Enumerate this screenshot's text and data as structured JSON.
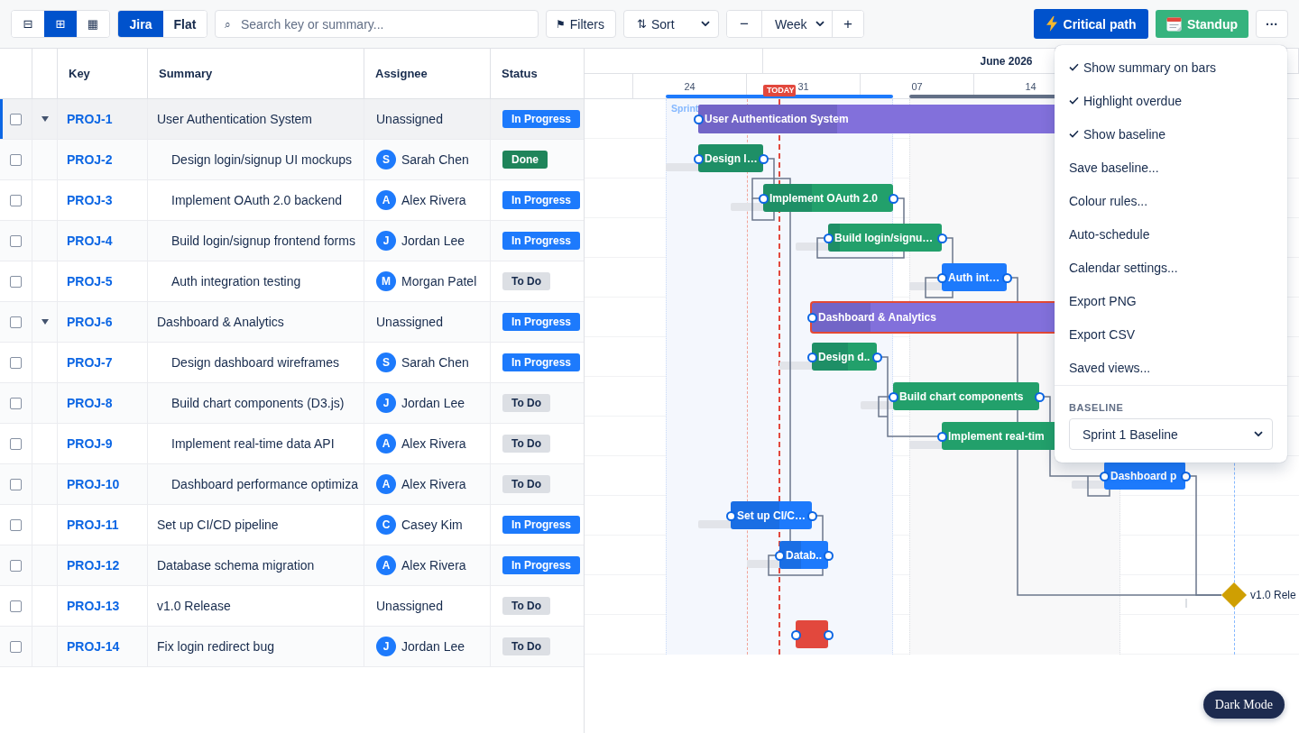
{
  "toolbar": {
    "view_modes": [
      {
        "icon": "⊟",
        "selected": false
      },
      {
        "icon": "⊞",
        "selected": true
      },
      {
        "icon": "▦",
        "selected": false
      }
    ],
    "hierarchy_modes": [
      {
        "label": "Jira",
        "selected": true
      },
      {
        "label": "Flat",
        "selected": false
      }
    ],
    "search": {
      "icon": "⌕",
      "placeholder": "Search key or summary..."
    },
    "filters": {
      "icon": "⚑",
      "label": "Filters"
    },
    "sort": {
      "icon": "⇅",
      "label": "Sort"
    },
    "zoom": {
      "decrease": "−",
      "scale": "Week",
      "increase": "+"
    },
    "critical_path": {
      "label": "Critical path"
    },
    "standup": {
      "label": "Standup"
    },
    "more": {
      "label": "···"
    }
  },
  "table": {
    "columns": [
      "Key",
      "Summary",
      "Assignee",
      "Status"
    ],
    "rows": [
      {
        "key": "PROJ-1",
        "summary": "User Authentication System",
        "assignee": {
          "name": "Unassigned"
        },
        "status": {
          "label": "In Progress",
          "kind": "in_progress"
        },
        "checked": false,
        "selected": true,
        "expanded": true,
        "bar": {
          "kind": "summary",
          "label": "User Authentication System",
          "color": "#8270db",
          "level": 0.39,
          "overdue": false
        },
        "children": [
          {
            "key": "PROJ-2",
            "summary": "Design login/signup UI mockups",
            "assignee": {
              "name": "Sarah Chen",
              "initial": "S"
            },
            "status": {
              "label": "Done",
              "kind": "done"
            },
            "checked": false,
            "selected": false,
            "bar": {
              "kind": "task",
              "label": "Design l…",
              "color": "#22a06b",
              "level": 1,
              "overdue": false
            }
          },
          {
            "key": "PROJ-3",
            "summary": "Implement OAuth 2.0 backend",
            "assignee": {
              "name": "Alex Rivera",
              "initial": "A"
            },
            "status": {
              "label": "In Progress",
              "kind": "in_progress"
            },
            "checked": false,
            "selected": false,
            "bar": {
              "kind": "task",
              "label": "Implement OAuth 2.0",
              "color": "#22a06b",
              "level": 0.375,
              "overdue": false
            }
          },
          {
            "key": "PROJ-4",
            "summary": "Build login/signup frontend forms",
            "assignee": {
              "name": "Jordan Lee",
              "initial": "J"
            },
            "status": {
              "label": "In Progress",
              "kind": "in_progress"
            },
            "checked": false,
            "selected": false,
            "bar": {
              "kind": "task",
              "label": "Build login/signu…",
              "color": "#22a06b",
              "level": 0.1,
              "overdue": false
            }
          },
          {
            "key": "PROJ-5",
            "summary": "Auth integration testing",
            "assignee": {
              "name": "Morgan Patel",
              "initial": "M"
            },
            "status": {
              "label": "To Do",
              "kind": "todo"
            },
            "checked": false,
            "selected": false,
            "bar": {
              "kind": "task",
              "label": "Auth int…",
              "color": "#1d7afc",
              "overdue": false
            }
          }
        ]
      },
      {
        "key": "PROJ-6",
        "summary": "Dashboard & Analytics",
        "assignee": {
          "name": "Unassigned"
        },
        "status": {
          "label": "In Progress",
          "kind": "in_progress"
        },
        "checked": false,
        "selected": false,
        "expanded": true,
        "bar": {
          "kind": "summary",
          "label": "Dashboard & Analytics",
          "color": "#8270db",
          "level": 0.24,
          "overdue": true
        },
        "children": [
          {
            "key": "PROJ-7",
            "summary": "Design dashboard wireframes",
            "assignee": {
              "name": "Sarah Chen",
              "initial": "S"
            },
            "status": {
              "label": "In Progress",
              "kind": "in_progress"
            },
            "checked": false,
            "selected": false,
            "bar": {
              "kind": "task",
              "label": "Design d..",
              "color": "#22a06b",
              "level": 0.55,
              "overdue": false
            }
          },
          {
            "key": "PROJ-8",
            "summary": "Build chart components (D3.js)",
            "assignee": {
              "name": "Jordan Lee",
              "initial": "J"
            },
            "status": {
              "label": "To Do",
              "kind": "todo"
            },
            "checked": false,
            "selected": false,
            "bar": {
              "kind": "task",
              "label": "Build chart components",
              "color": "#22a06b",
              "overdue": false
            }
          },
          {
            "key": "PROJ-9",
            "summary": "Implement real-time data API",
            "assignee": {
              "name": "Alex Rivera",
              "initial": "A"
            },
            "status": {
              "label": "To Do",
              "kind": "todo"
            },
            "checked": false,
            "selected": false,
            "bar": {
              "kind": "task",
              "label": "Implement real-tim",
              "color": "#22a06b",
              "overdue": false
            }
          },
          {
            "key": "PROJ-10",
            "summary": "Dashboard performance optimiza",
            "assignee": {
              "name": "Alex Rivera",
              "initial": "A"
            },
            "status": {
              "label": "To Do",
              "kind": "todo"
            },
            "checked": false,
            "selected": false,
            "bar": {
              "kind": "task",
              "label": "Dashboard p",
              "color": "#1d7afc",
              "overdue": false
            }
          }
        ]
      },
      {
        "key": "PROJ-11",
        "summary": "Set up CI/CD pipeline",
        "assignee": {
          "name": "Casey Kim",
          "initial": "C"
        },
        "status": {
          "label": "In Progress",
          "kind": "in_progress"
        },
        "checked": false,
        "selected": false,
        "bar": {
          "kind": "task",
          "label": "Set up CI/C…",
          "color": "#1d7afc",
          "level": 0.6,
          "overdue": false
        }
      },
      {
        "key": "PROJ-12",
        "summary": "Database schema migration",
        "assignee": {
          "name": "Alex Rivera",
          "initial": "A"
        },
        "status": {
          "label": "In Progress",
          "kind": "in_progress"
        },
        "checked": false,
        "selected": false,
        "bar": {
          "kind": "task",
          "label": "Datab..",
          "color": "#1d7afc",
          "level": 0.45,
          "overdue": false
        }
      },
      {
        "key": "PROJ-13",
        "summary": "v1.0 Release",
        "assignee": {
          "name": "Unassigned"
        },
        "status": {
          "label": "To Do",
          "kind": "todo"
        },
        "checked": false,
        "selected": false,
        "bar": {
          "kind": "milestone",
          "label": "v1.0 Rele",
          "color": "#cf9f02"
        }
      },
      {
        "key": "PROJ-14",
        "summary": "Fix login redirect bug",
        "assignee": {
          "name": "Jordan Lee",
          "initial": "J"
        },
        "status": {
          "label": "To Do",
          "kind": "todo"
        },
        "checked": false,
        "selected": false,
        "bar": {
          "kind": "task",
          "color": "#e2483d",
          "overdue": false
        }
      }
    ]
  },
  "gantt": {
    "months": [
      {
        "label": "June 2026"
      }
    ],
    "weeks": [
      {
        "label": "24"
      },
      {
        "label": "31"
      },
      {
        "label": "07"
      },
      {
        "label": "14"
      }
    ],
    "today": {
      "label": "TODAY"
    },
    "sprints": [
      {
        "label": "Sprint",
        "active": true
      },
      {
        "active": false
      }
    ]
  },
  "options_menu": {
    "items": [
      {
        "label": "Show summary on bars",
        "checked": true
      },
      {
        "label": "Highlight overdue",
        "checked": true
      },
      {
        "label": "Show baseline",
        "checked": true
      },
      {
        "label": "Save baseline...",
        "checked": false
      },
      {
        "label": "Colour rules...",
        "checked": false
      },
      {
        "label": "Auto-schedule",
        "checked": false
      },
      {
        "label": "Calendar settings...",
        "checked": false
      },
      {
        "label": "Export PNG",
        "checked": false
      },
      {
        "label": "Export CSV",
        "checked": false
      },
      {
        "label": "Saved views...",
        "checked": false
      }
    ],
    "baseline": {
      "label": "BASELINE",
      "value": "Sprint 1 Baseline"
    }
  },
  "theme_toggle": {
    "label": "Dark Mode"
  }
}
